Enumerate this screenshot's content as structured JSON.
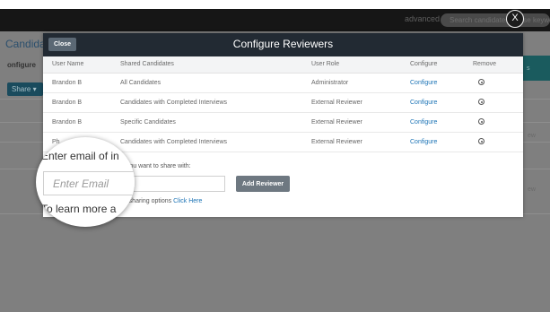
{
  "background": {
    "advanced_label": "advanced",
    "search_placeholder": "Search candidates or use keywords",
    "close_symbol": "X",
    "page_title_partial": "Candida",
    "configure_tab": "onfigure",
    "share_button": "Share ▾",
    "right_strip_text": "s",
    "right_snippets": [
      "ew",
      "ew"
    ]
  },
  "modal": {
    "close_label": "Close",
    "title": "Configure Reviewers",
    "columns": [
      "User Name",
      "Shared Candidates",
      "User Role",
      "Configure",
      "Remove"
    ],
    "rows": [
      {
        "user": "Brandon B",
        "shared": "All Candidates",
        "role": "Administrator",
        "configure": "Configure",
        "remove_icon": "remove-circle-icon"
      },
      {
        "user": "Brandon B",
        "shared": "Candidates with Completed Interviews",
        "role": "External Reviewer",
        "configure": "Configure",
        "remove_icon": "remove-circle-icon"
      },
      {
        "user": "Brandon B",
        "shared": "Specific Candidates",
        "role": "External Reviewer",
        "configure": "Configure",
        "remove_icon": "remove-circle-icon"
      },
      {
        "user": "Ph",
        "shared": "Candidates with Completed Interviews",
        "role": "External Reviewer",
        "configure": "Configure",
        "remove_icon": "remove-circle-icon"
      }
    ],
    "email_prompt": "ail you want to share with:",
    "email_value": "",
    "add_button": "Add Reviewer",
    "learn_more_prefix": "the sharing options",
    "learn_more_link": "Click Here"
  },
  "magnifier": {
    "label": "Enter email of in",
    "input_placeholder": "Enter Email",
    "learn_more": "To learn more a"
  }
}
